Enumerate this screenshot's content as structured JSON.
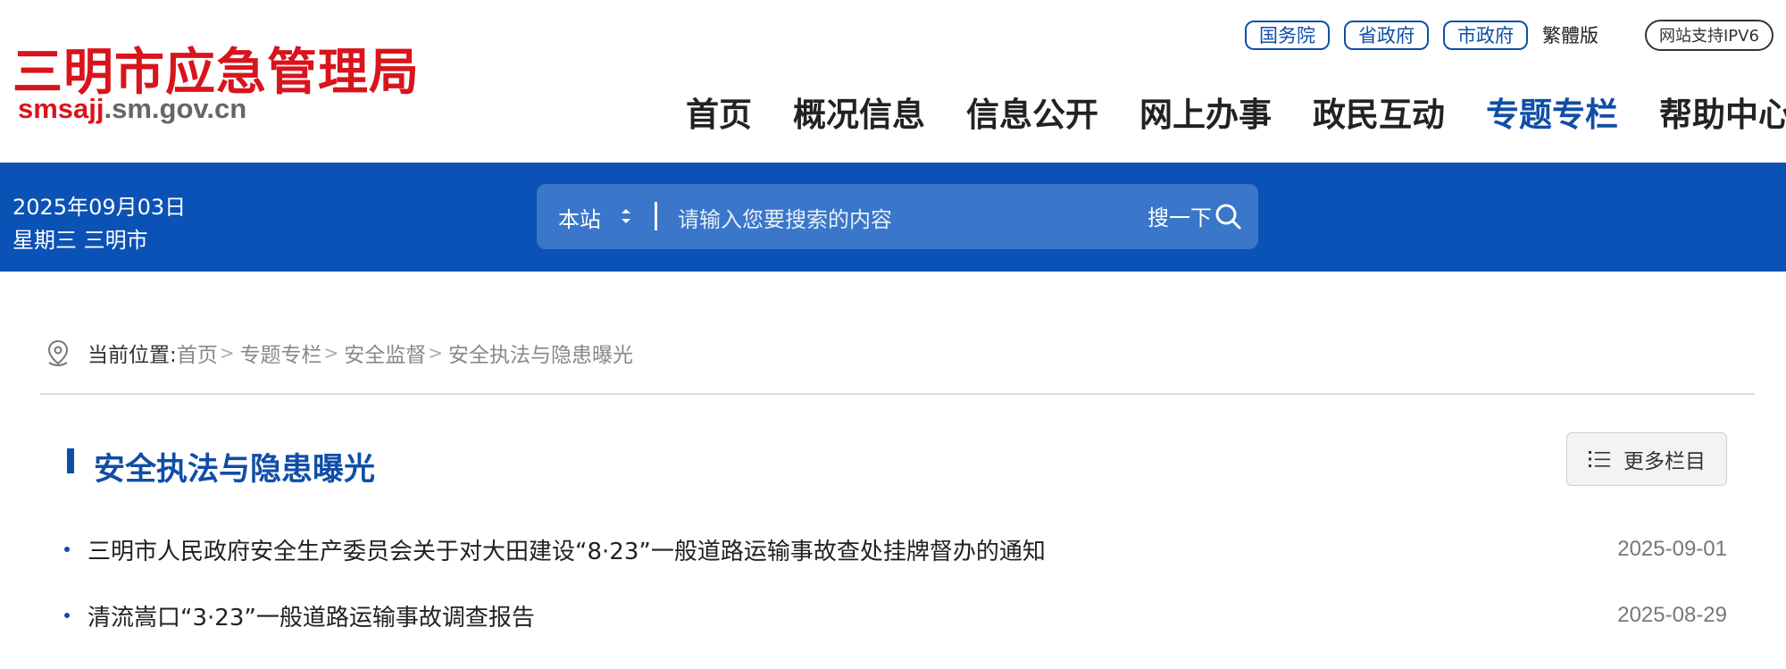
{
  "logo": {
    "title": "三明市应急管理局",
    "url_red": "smsajj",
    "url_gray": ".sm.gov.cn"
  },
  "top_links": [
    {
      "label": "国务院"
    },
    {
      "label": "省政府"
    },
    {
      "label": "市政府"
    }
  ],
  "traditional_label": "繁體版",
  "ipv6_label": "网站支持IPV6",
  "nav": [
    {
      "label": "首页",
      "active": false
    },
    {
      "label": "概况信息",
      "active": false
    },
    {
      "label": "信息公开",
      "active": false
    },
    {
      "label": "网上办事",
      "active": false
    },
    {
      "label": "政民互动",
      "active": false
    },
    {
      "label": "专题专栏",
      "active": true
    },
    {
      "label": "帮助中心",
      "active": false
    }
  ],
  "date": {
    "line1": "2025年09月03日",
    "line2": "星期三 三明市"
  },
  "search": {
    "scope": "本站",
    "placeholder": "请输入您要搜索的内容",
    "button_label": "搜一下"
  },
  "breadcrumb": {
    "lead": "当前位置:",
    "items": [
      "首页",
      "专题专栏",
      "安全监督",
      "安全执法与隐患曝光"
    ],
    "separator": ">"
  },
  "section": {
    "title": "安全执法与隐患曝光",
    "more_label": "更多栏目"
  },
  "articles": [
    {
      "title": "三明市人民政府安全生产委员会关于对大田建设“8·23”一般道路运输事故查处挂牌督办的通知",
      "date": "2025-09-01"
    },
    {
      "title": "清流嵩口“3·23”一般道路运输事故调查报告",
      "date": "2025-08-29"
    }
  ],
  "colors": {
    "brand_blue": "#0a52b5",
    "logo_red": "#d8141c"
  }
}
